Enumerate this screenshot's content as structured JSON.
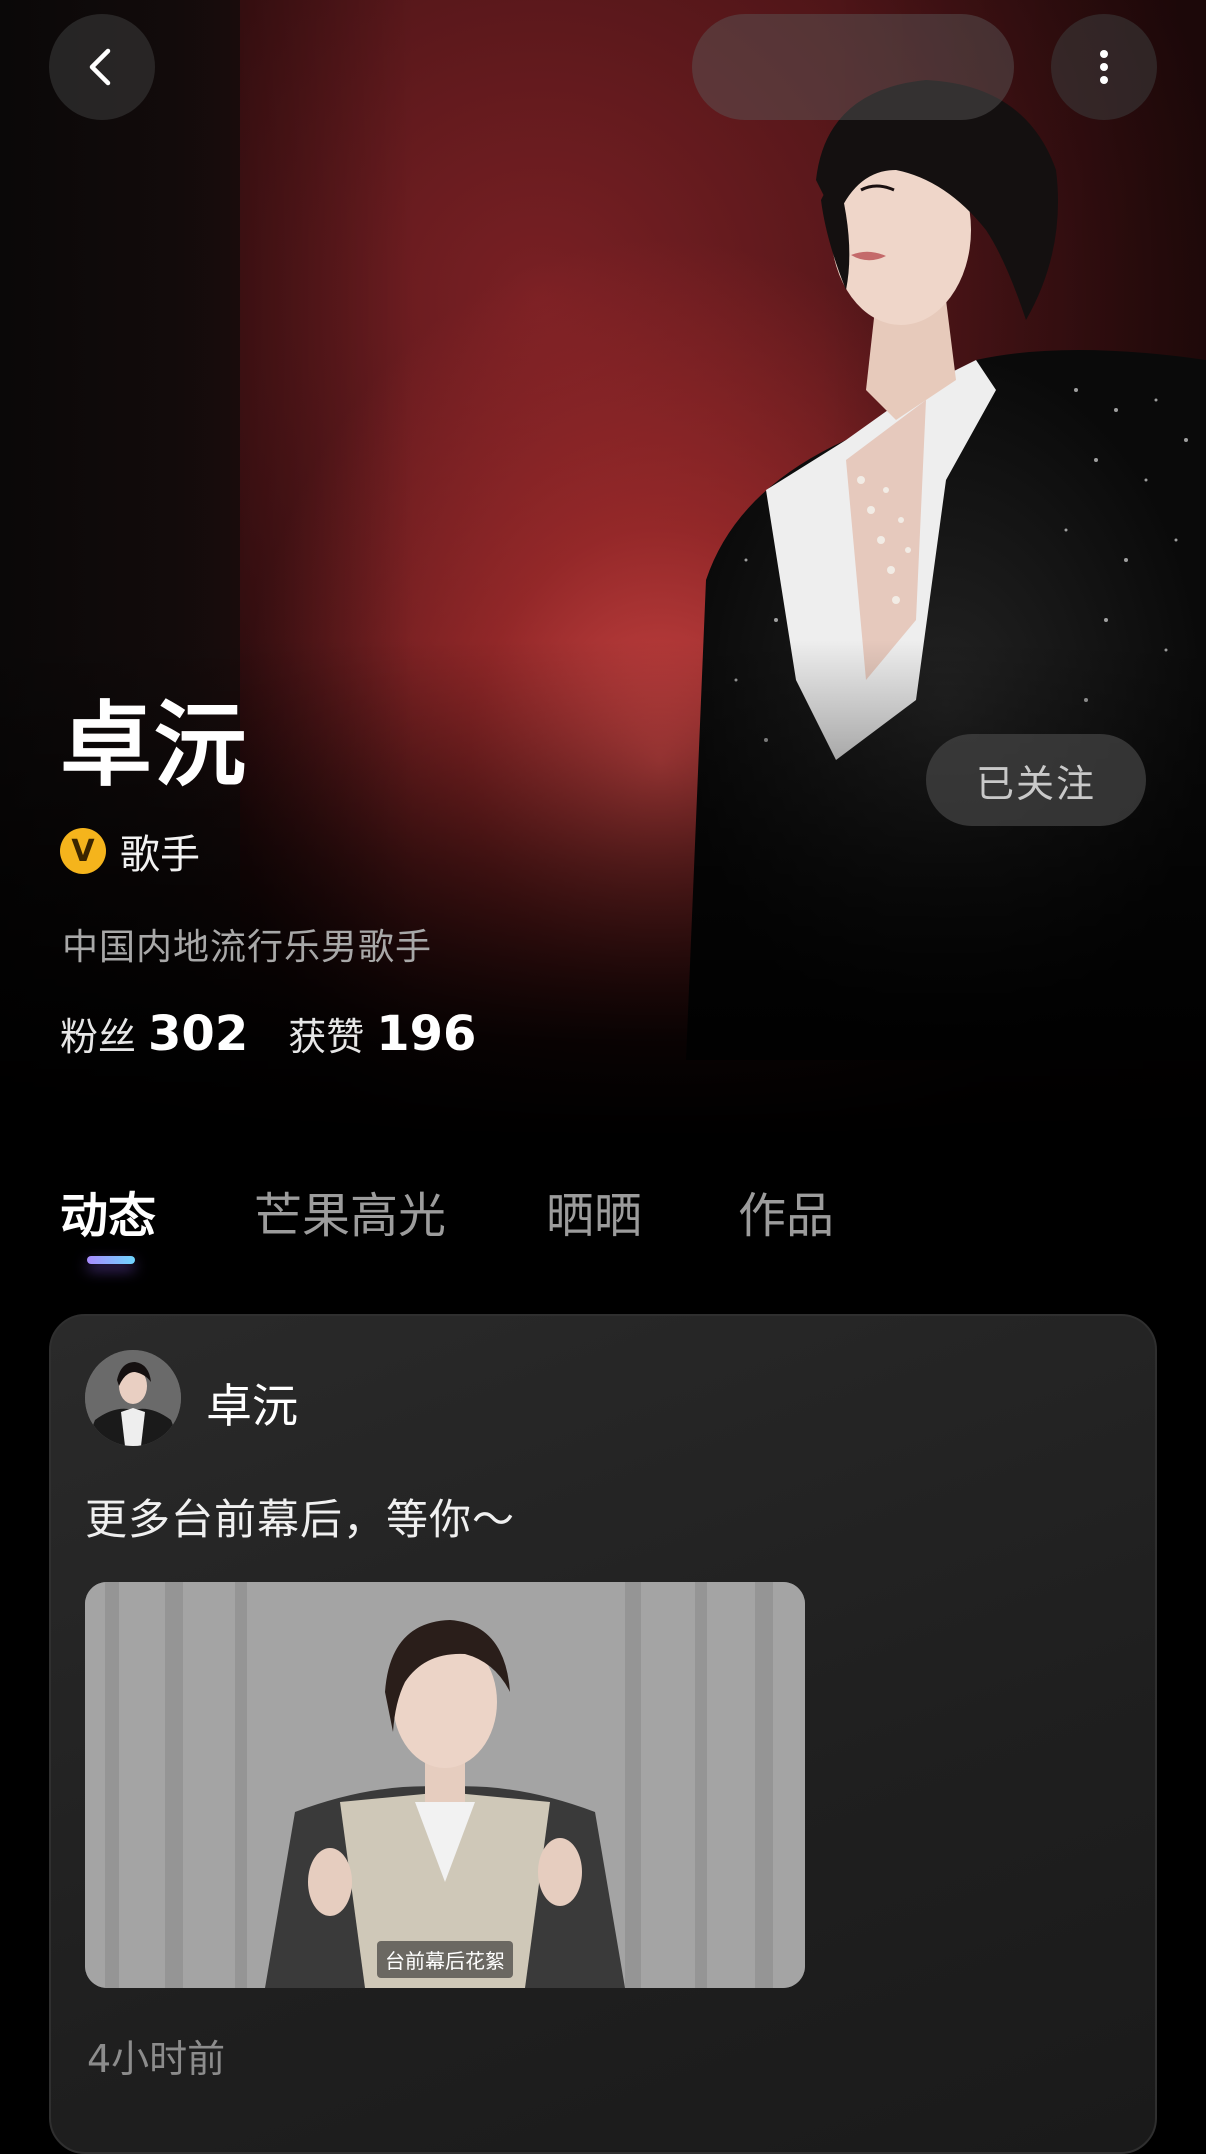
{
  "header": {
    "back_icon": "chevron-left-icon",
    "more_icon": "more-vertical-icon"
  },
  "profile": {
    "name": "卓沅",
    "badge": "V",
    "badge_color": "#f5b41c",
    "role": "歌手",
    "bio": "中国内地流行乐男歌手",
    "follow_label": "已关注",
    "stats": [
      {
        "label": "粉丝",
        "value": "302"
      },
      {
        "label": "获赞",
        "value": "196"
      }
    ]
  },
  "tabs": [
    {
      "label": "动态",
      "active": true
    },
    {
      "label": "芒果高光",
      "active": false
    },
    {
      "label": "晒晒",
      "active": false
    },
    {
      "label": "作品",
      "active": false
    }
  ],
  "post": {
    "author": "卓沅",
    "text": "更多台前幕后，等你～",
    "thumb_caption": "台前幕后花絮",
    "time": "4小时前"
  }
}
